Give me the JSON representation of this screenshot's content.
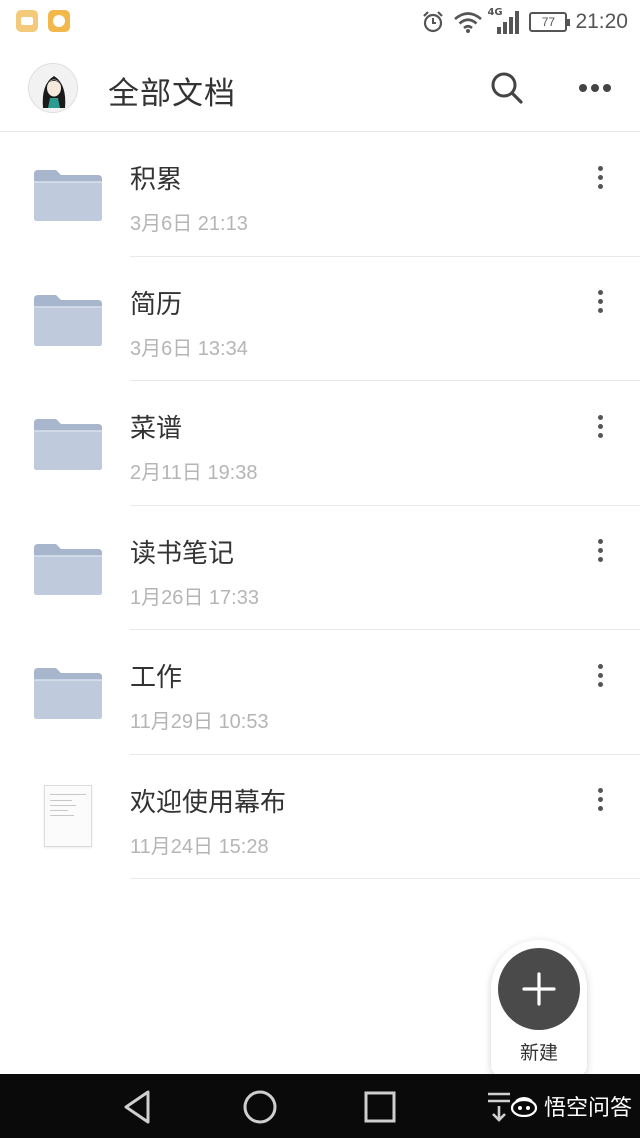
{
  "status_bar": {
    "time": "21:20",
    "battery": "77",
    "network": "4G"
  },
  "header": {
    "title": "全部文档"
  },
  "documents": [
    {
      "title": "积累",
      "date": "3月6日 21:13",
      "type": "folder"
    },
    {
      "title": "简历",
      "date": "3月6日 13:34",
      "type": "folder"
    },
    {
      "title": "菜谱",
      "date": "2月11日 19:38",
      "type": "folder"
    },
    {
      "title": "读书笔记",
      "date": "1月26日 17:33",
      "type": "folder"
    },
    {
      "title": "工作",
      "date": "11月29日 10:53",
      "type": "folder"
    },
    {
      "title": "欢迎使用幕布",
      "date": "11月24日 15:28",
      "type": "document"
    }
  ],
  "fab": {
    "label": "新建",
    "icon": "plus-icon"
  },
  "watermark": {
    "text": "悟空问答"
  },
  "colors": {
    "folder_fill": "#b9c6d8",
    "fab": "#4a4a4a",
    "date_text": "#b5b5b5"
  }
}
